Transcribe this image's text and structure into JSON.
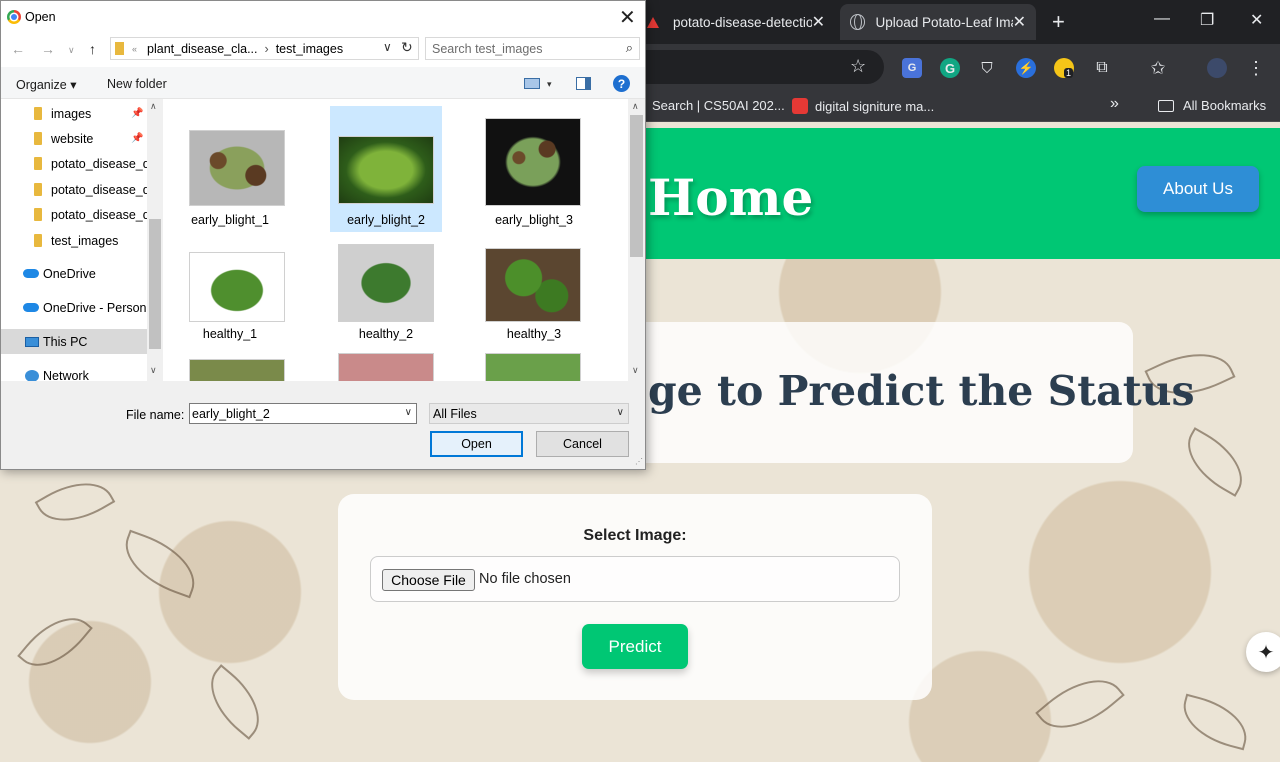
{
  "browser": {
    "tabs": [
      {
        "title": "potato-disease-detectio"
      },
      {
        "title": "Upload Potato-Leaf Ima"
      }
    ],
    "bookmarks": [
      {
        "label": "Search | CS50AI 202..."
      },
      {
        "label": "digital signiture ma..."
      }
    ],
    "all_bookmarks": "All Bookmarks",
    "overflow": "»",
    "extension_badge": "1"
  },
  "page": {
    "nav_title": "Home",
    "about_button": "About Us",
    "headline": "ge to Predict the Status",
    "form": {
      "select_label": "Select Image:",
      "choose_button": "Choose File",
      "no_file_text": "No file chosen",
      "predict_button": "Predict"
    },
    "colors": {
      "accent": "#00c774",
      "about": "#2e8ed6",
      "headline": "#2c3e50"
    }
  },
  "dialog": {
    "title": "Open",
    "path": [
      "plant_disease_cla...",
      "test_images"
    ],
    "search_placeholder": "Search test_images",
    "organize": "Organize",
    "new_folder": "New folder",
    "nav_items": [
      {
        "label": "images",
        "icon": "folder-icon",
        "pinned": true
      },
      {
        "label": "website",
        "icon": "folder-icon",
        "pinned": true
      },
      {
        "label": "potato_disease_d",
        "icon": "folder-icon",
        "pinned": false
      },
      {
        "label": "potato_disease_d",
        "icon": "folder-icon",
        "pinned": false
      },
      {
        "label": "potato_disease_d",
        "icon": "folder-icon",
        "pinned": false
      },
      {
        "label": "test_images",
        "icon": "folder-icon",
        "pinned": false
      },
      {
        "label": "OneDrive",
        "icon": "cloud-icon",
        "pinned": false
      },
      {
        "label": "OneDrive - Person",
        "icon": "cloud-icon",
        "pinned": false
      },
      {
        "label": "This PC",
        "icon": "pc-icon",
        "pinned": false
      },
      {
        "label": "Network",
        "icon": "network-icon",
        "pinned": false
      }
    ],
    "files": [
      {
        "name": "early_blight_1",
        "selected": false
      },
      {
        "name": "early_blight_2",
        "selected": true
      },
      {
        "name": "early_blight_3",
        "selected": false
      },
      {
        "name": "healthy_1",
        "selected": false
      },
      {
        "name": "healthy_2",
        "selected": false
      },
      {
        "name": "healthy_3",
        "selected": false
      }
    ],
    "file_name_label": "File name:",
    "file_name_value": "early_blight_2",
    "filter_value": "All Files",
    "open_button": "Open",
    "cancel_button": "Cancel"
  }
}
